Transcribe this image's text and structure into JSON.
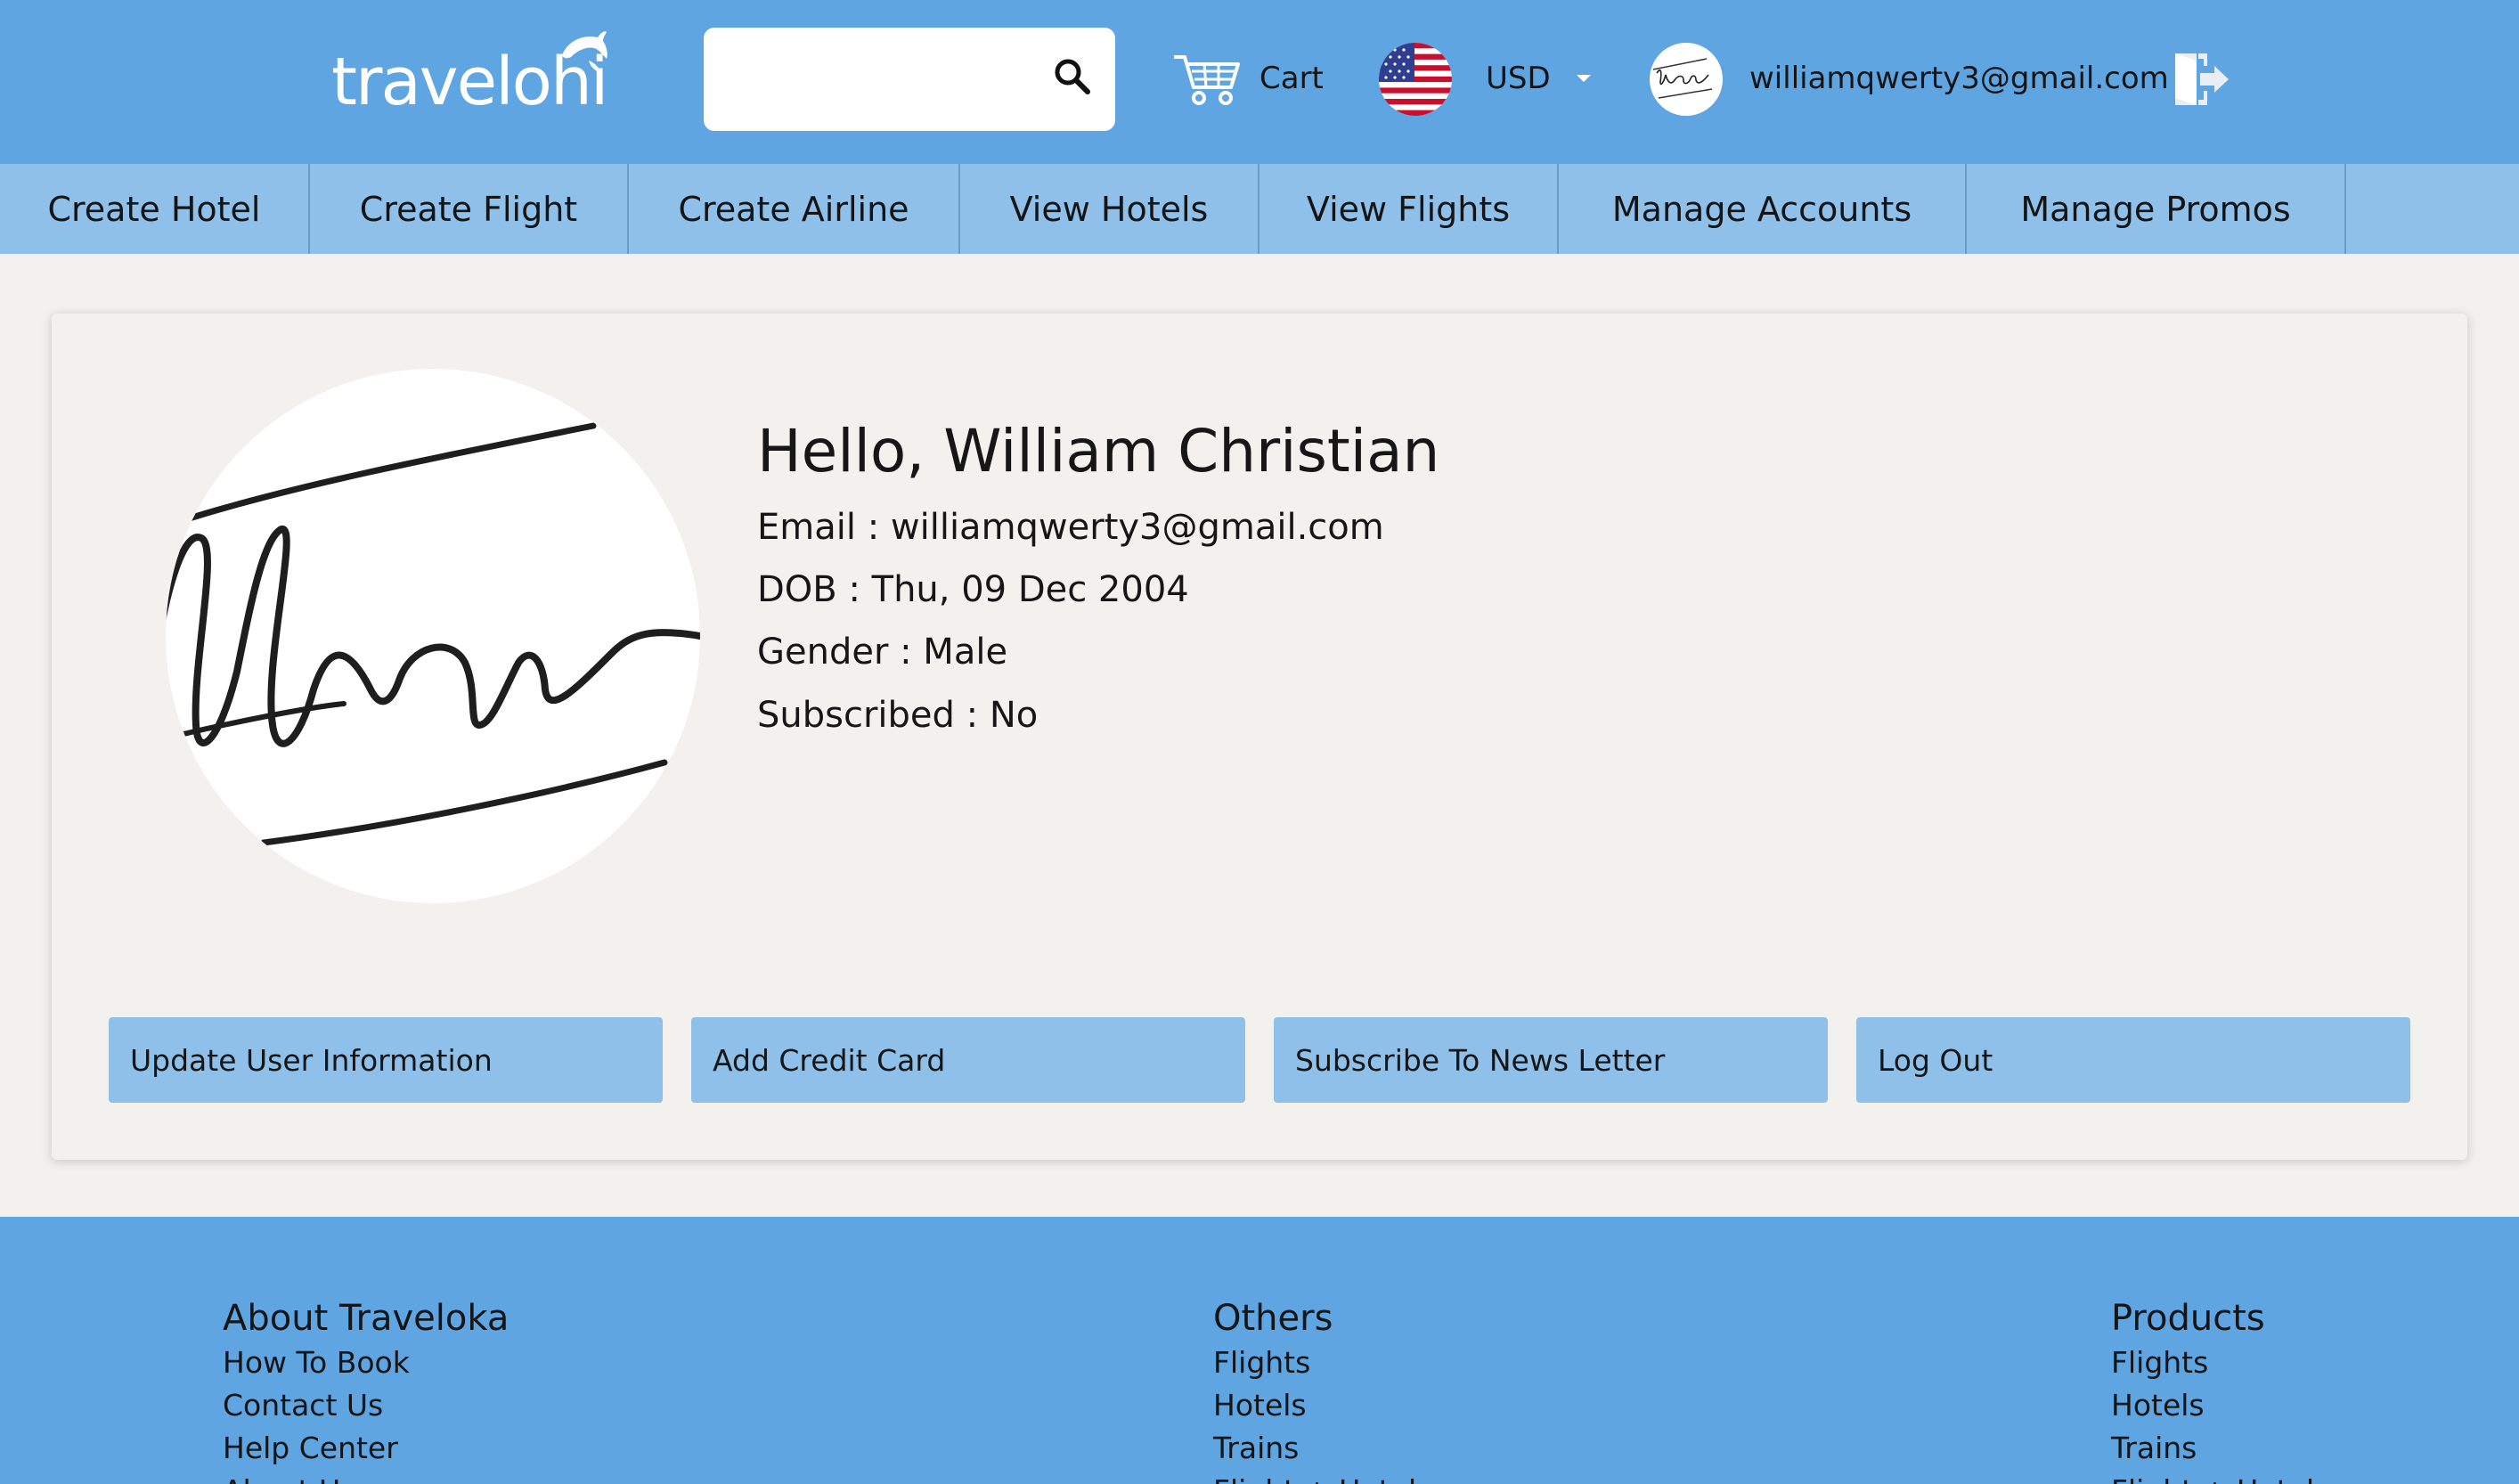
{
  "header": {
    "logo_text": "travelohi",
    "search_placeholder": "",
    "cart_label": "Cart",
    "currency": "USD",
    "user_email": "williamqwerty3@gmail.com"
  },
  "nav": {
    "items": [
      "Create Hotel",
      "Create Flight",
      "Create Airline",
      "View Hotels",
      "View Flights",
      "Manage Accounts",
      "Manage Promos"
    ]
  },
  "profile": {
    "greeting": "Hello, William Christian",
    "email": "Email : williamqwerty3@gmail.com",
    "dob": "DOB : Thu, 09 Dec 2004",
    "gender": "Gender : Male",
    "subscribed": "Subscribed : No"
  },
  "actions": {
    "update": "Update User Information",
    "add_card": "Add Credit Card",
    "subscribe": "Subscribe To News Letter",
    "logout": "Log Out"
  },
  "footer": {
    "about": {
      "title": "About Traveloka",
      "links": [
        "How To Book",
        "Contact Us",
        "Help Center",
        "About Us"
      ]
    },
    "others": {
      "title": "Others",
      "links": [
        "Flights",
        "Hotels",
        "Trains",
        "Flight + Hotel"
      ]
    },
    "products": {
      "title": "Products",
      "links": [
        "Flights",
        "Hotels",
        "Trains",
        "Flight + Hotel"
      ]
    }
  },
  "colors": {
    "header_bg": "#5ea5e2",
    "nav_bg": "#8ec0e9",
    "page_bg": "#f2f1ee",
    "button_bg": "#8ec0e9"
  },
  "icons": {
    "search": "search-icon",
    "cart": "cart-icon",
    "flag": "us-flag-icon",
    "caret": "chevron-down-icon",
    "logout": "logout-icon",
    "logo_mark": "dolphin-icon"
  }
}
